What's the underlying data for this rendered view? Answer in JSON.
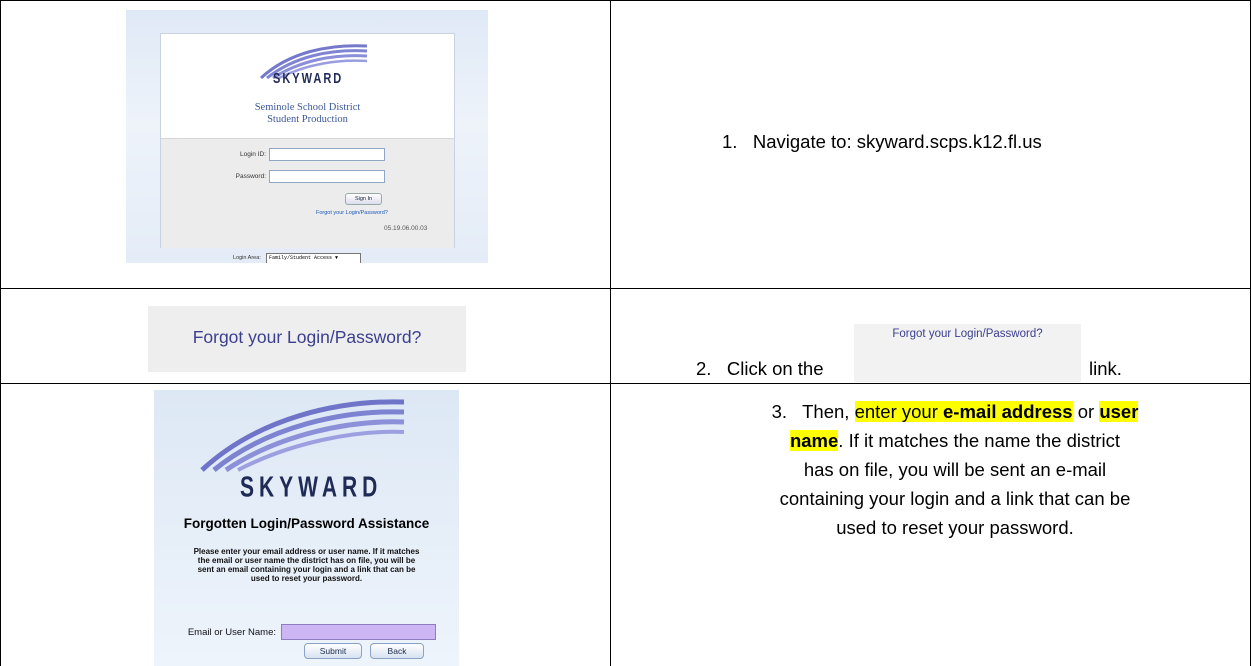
{
  "row1": {
    "brand": "SKYWARD",
    "school_line1": "Seminole School District",
    "school_line2": "Student Production",
    "login_id_label": "Login ID:",
    "password_label": "Password:",
    "sign_in_label": "Sign In",
    "forgot_link": "Forgot your Login/Password?",
    "version": "05.19.06.00.03",
    "login_area_label": "Login Area:",
    "login_area_value": "Family/Student Access ▼",
    "step_number": "1.",
    "step_text": "Navigate to: skyward.scps.k12.fl.us"
  },
  "row2": {
    "forgot_big": "Forgot your Login/Password?",
    "step_number": "2.",
    "step_prefix": "Click on the",
    "inline_button": "Forgot your Login/Password?",
    "step_suffix": "link."
  },
  "row3": {
    "brand": "SKYWARD",
    "title": "Forgotten Login/Password Assistance",
    "body_line1": "Please enter your email address or user name.  If it matches",
    "body_line2": "the email or user name the district has on file, you will be",
    "body_line3": "sent an email containing your login and a link that can be",
    "body_line4": "used to reset your password.",
    "email_label": "Email or User Name:",
    "submit_label": "Submit",
    "back_label": "Back",
    "step_number": "3.",
    "step_then": "Then,",
    "step_enter": "enter your",
    "step_email": "e-mail address",
    "step_or": "or",
    "step_user": "user",
    "step_name": "name",
    "step_rest1": ". If it matches the name the district",
    "step_rest2": "has on file, you will be sent an e-mail",
    "step_rest3": "containing your login and a link that can be",
    "step_rest4": "used to reset your password."
  },
  "colors": {
    "highlight": "#ffff00",
    "brand_navy": "#1f2a56",
    "swoosh": "#6f74c9",
    "link": "#3b3f8f"
  }
}
